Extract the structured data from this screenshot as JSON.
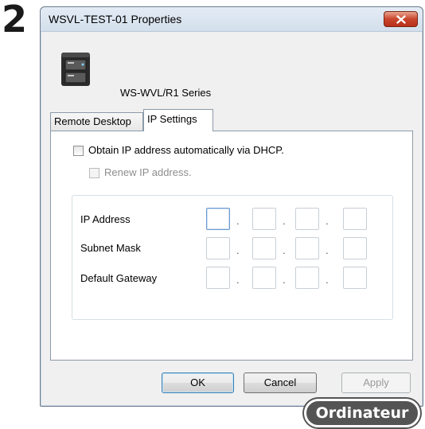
{
  "step": {
    "number": "2"
  },
  "window": {
    "title": "WSVL-TEST-01 Properties",
    "close_icon": "close-icon"
  },
  "device": {
    "icon": "nas-device-icon",
    "series_name": "WS-WVL/R1 Series"
  },
  "tabs": [
    {
      "label": "Remote Desktop",
      "active": false
    },
    {
      "label": "IP Settings",
      "active": true
    }
  ],
  "ip_settings": {
    "dhcp_checkbox": {
      "label": "Obtain IP address automatically via DHCP.",
      "checked": false
    },
    "renew_checkbox": {
      "label": "Renew IP address.",
      "checked": false,
      "enabled": false
    },
    "fields": [
      {
        "label": "IP Address",
        "octets": [
          "",
          "",
          "",
          ""
        ]
      },
      {
        "label": "Subnet Mask",
        "octets": [
          "",
          "",
          "",
          ""
        ]
      },
      {
        "label": "Default Gateway",
        "octets": [
          "",
          "",
          "",
          ""
        ]
      }
    ],
    "separator": "."
  },
  "buttons": {
    "ok": "OK",
    "cancel": "Cancel",
    "apply": "Apply"
  },
  "badge": {
    "label": "Ordinateur"
  },
  "colors": {
    "close_button": "#c9452c",
    "badge_bg": "#545454"
  }
}
